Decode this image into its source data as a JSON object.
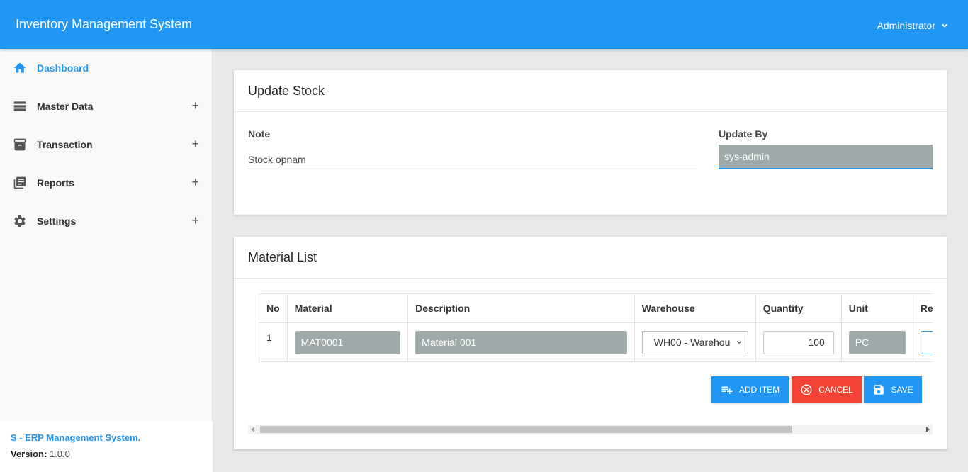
{
  "header": {
    "title": "Inventory Management System",
    "user": "Administrator"
  },
  "sidebar": {
    "items": [
      {
        "label": "Dashboard",
        "icon": "home-icon",
        "active": true,
        "expandable": false
      },
      {
        "label": "Master Data",
        "icon": "list-icon",
        "active": false,
        "expandable": true
      },
      {
        "label": "Transaction",
        "icon": "archive-icon",
        "active": false,
        "expandable": true
      },
      {
        "label": "Reports",
        "icon": "library-books-icon",
        "active": false,
        "expandable": true
      },
      {
        "label": "Settings",
        "icon": "gear-icon",
        "active": false,
        "expandable": true
      }
    ],
    "expand_symbol": "+",
    "footer": {
      "brand": "S - ERP Management System.",
      "version_label": "Version:",
      "version_value": "1.0.0"
    }
  },
  "update_stock": {
    "title": "Update Stock",
    "note_label": "Note",
    "note_value": "Stock opnam",
    "update_by_label": "Update By",
    "update_by_value": "sys-admin"
  },
  "material_list": {
    "title": "Material List",
    "columns": [
      "No",
      "Material",
      "Description",
      "Warehouse",
      "Quantity",
      "Unit",
      "Re"
    ],
    "rows": [
      {
        "no": "1",
        "material": "MAT0001",
        "description": "Material 001",
        "warehouse": "WH00 - Warehou",
        "quantity": "100",
        "unit": "PC"
      }
    ],
    "buttons": {
      "add_item": "ADD ITEM",
      "cancel": "CANCEL",
      "save": "SAVE"
    }
  },
  "colors": {
    "primary": "#2196f3",
    "danger": "#f44336",
    "readonly_bg": "#9eaaa9"
  }
}
